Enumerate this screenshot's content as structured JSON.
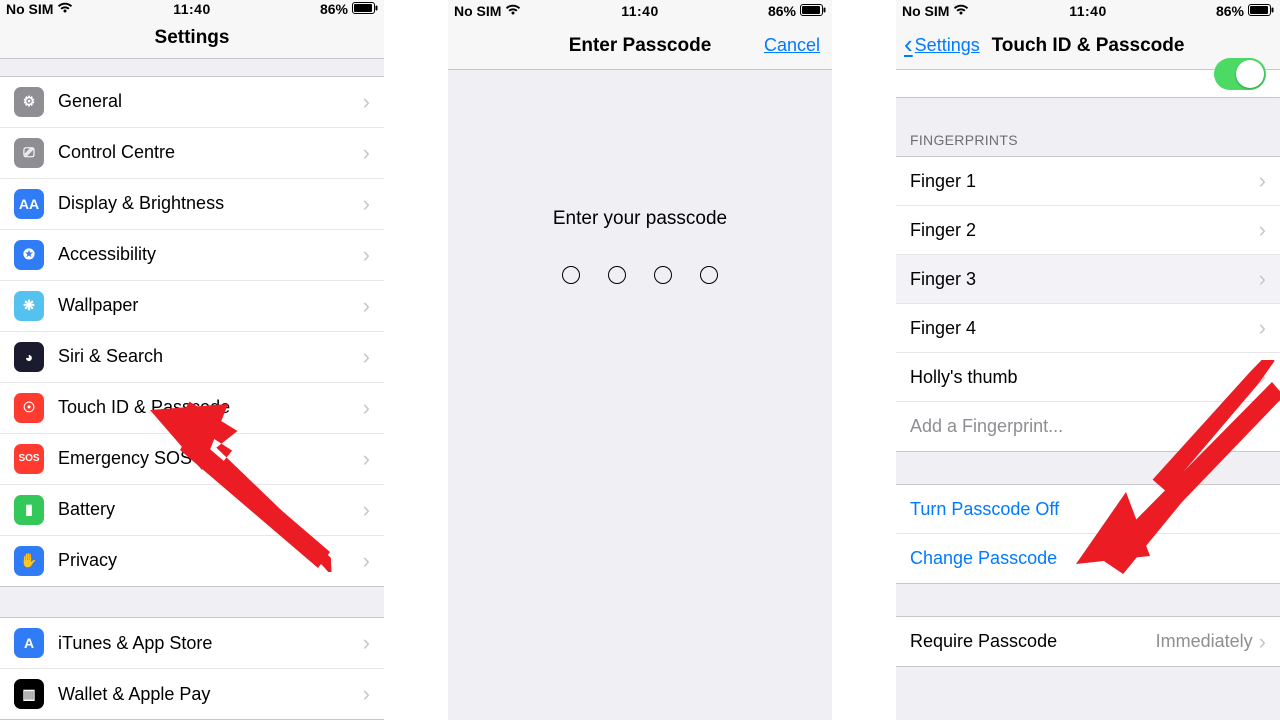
{
  "status": {
    "carrier": "No SIM",
    "time": "11:40",
    "battery_pct": "86%"
  },
  "screen1": {
    "title": "Settings",
    "groups": [
      [
        {
          "label": "General",
          "icon_bg": "#8e8e93",
          "icon_glyph": "⚙"
        },
        {
          "label": "Control Centre",
          "icon_bg": "#8e8e93",
          "icon_glyph": "⎚"
        },
        {
          "label": "Display & Brightness",
          "icon_bg": "#2f7cf6",
          "icon_glyph": "AA"
        },
        {
          "label": "Accessibility",
          "icon_bg": "#2f7cf6",
          "icon_glyph": "✪"
        },
        {
          "label": "Wallpaper",
          "icon_bg": "#54c1ef",
          "icon_glyph": "❋"
        },
        {
          "label": "Siri & Search",
          "icon_bg": "#1b1b2f",
          "icon_glyph": "◕"
        },
        {
          "label": "Touch ID & Passcode",
          "icon_bg": "#ff3b30",
          "icon_glyph": "☉"
        },
        {
          "label": "Emergency SOS",
          "icon_bg": "#ff3b30",
          "icon_glyph": "SOS"
        },
        {
          "label": "Battery",
          "icon_bg": "#34c759",
          "icon_glyph": "▮"
        },
        {
          "label": "Privacy",
          "icon_bg": "#2f7cf6",
          "icon_glyph": "✋"
        }
      ],
      [
        {
          "label": "iTunes & App Store",
          "icon_bg": "#2f7cf6",
          "icon_glyph": "A"
        },
        {
          "label": "Wallet & Apple Pay",
          "icon_bg": "#000",
          "icon_glyph": "▥"
        }
      ]
    ]
  },
  "screen2": {
    "title": "Enter Passcode",
    "cancel": "Cancel",
    "prompt": "Enter your passcode",
    "digits": 4
  },
  "screen3": {
    "back": "Settings",
    "title": "Touch ID & Passcode",
    "fingerprints_header": "FINGERPRINTS",
    "fingerprints": [
      "Finger 1",
      "Finger 2",
      "Finger 3",
      "Finger 4",
      "Holly's thumb"
    ],
    "highlighted_index": 2,
    "add_fingerprint": "Add a Fingerprint...",
    "actions": [
      "Turn Passcode Off",
      "Change Passcode"
    ],
    "require_label": "Require Passcode",
    "require_value": "Immediately"
  }
}
